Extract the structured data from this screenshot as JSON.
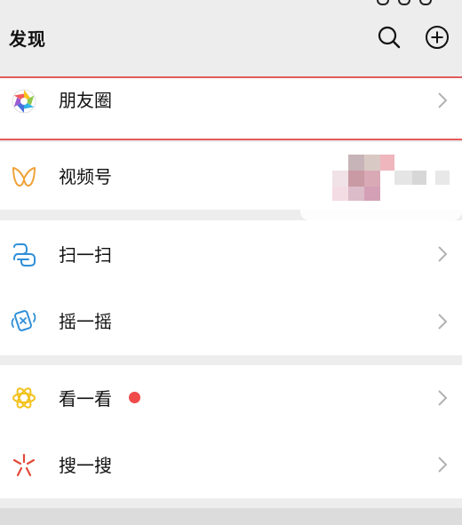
{
  "header": {
    "title": "发现"
  },
  "items": {
    "moments": {
      "label": "朋友圈",
      "icon": "moments-camera-icon"
    },
    "channels": {
      "label": "视频号",
      "icon": "channels-butterfly-icon"
    },
    "scan": {
      "label": "扫一扫",
      "icon": "scan-icon"
    },
    "shake": {
      "label": "摇一摇",
      "icon": "shake-phone-icon"
    },
    "top_stories": {
      "label": "看一看",
      "icon": "top-stories-icon",
      "has_red_dot": true
    },
    "search": {
      "label": "搜一搜",
      "icon": "search-spark-icon"
    }
  },
  "colors": {
    "background": "#ededed",
    "highlight_border": "#e45b5b",
    "badge": "#f04a4a",
    "chevron": "#b2b2b2"
  }
}
